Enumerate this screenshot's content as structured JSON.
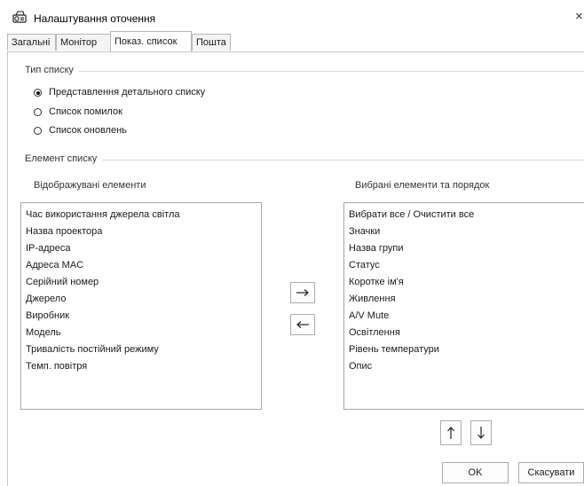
{
  "window": {
    "title": "Налаштування оточення",
    "close_glyph": "×"
  },
  "tabs": [
    {
      "label": "Загальні",
      "active": false
    },
    {
      "label": "Монітор",
      "active": false
    },
    {
      "label": "Показ. список",
      "active": true
    },
    {
      "label": "Пошта",
      "active": false
    }
  ],
  "list_type": {
    "group_label": "Тип списку",
    "options": [
      {
        "label": "Представлення детального списку",
        "selected": true
      },
      {
        "label": "Список помилок",
        "selected": false
      },
      {
        "label": "Список оновлень",
        "selected": false
      }
    ]
  },
  "list_item": {
    "group_label": "Елемент списку",
    "displayed_caption": "Відображувані елементи",
    "selected_caption": "Вибрані елементи та порядок",
    "displayed_items": [
      "Час використання джерела світла",
      "Назва проектора",
      "IP-адреса",
      "Адреса MAC",
      "Серійний номер",
      "Джерело",
      "Виробник",
      "Модель",
      "Тривалість постійний режиму",
      "Темп. повітря"
    ],
    "selected_items": [
      "Вибрати все / Очистити все",
      "Значки",
      "Назва групи",
      "Статус",
      "Коротке ім'я",
      "Живлення",
      "A/V Mute",
      "Освітлення",
      "Рівень температури",
      "Опис"
    ]
  },
  "icons": {
    "app": "projector-icon",
    "move_right": "arrow-right-icon",
    "move_left": "arrow-left-icon",
    "move_up": "arrow-up-icon",
    "move_down": "arrow-down-icon"
  },
  "footer": {
    "ok_label": "OK",
    "cancel_label": "Скасувати"
  }
}
